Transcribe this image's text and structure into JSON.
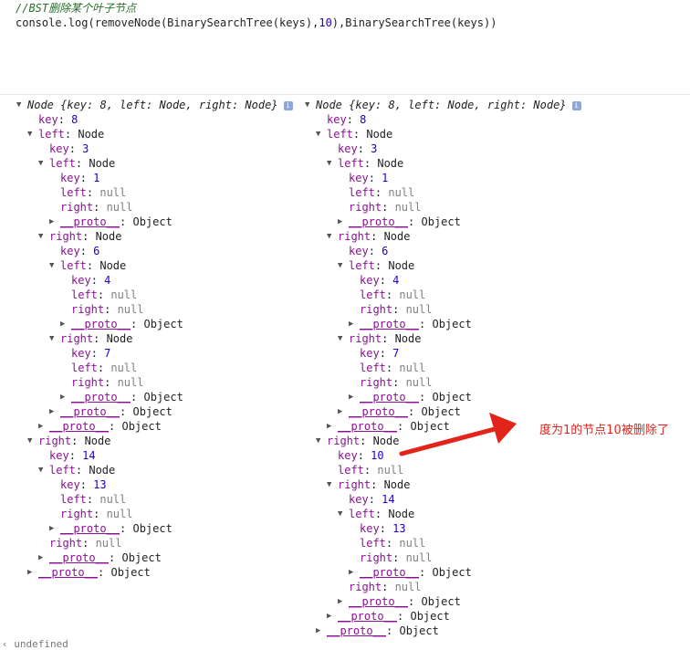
{
  "code": {
    "comment": "//BST删除某个叶子节点",
    "call_prefix": "console.log(removeNode(BinarySearchTree(keys),",
    "call_num": "10",
    "call_suffix": "),BinarySearchTree(keys))"
  },
  "left_tree": [
    {
      "kind": "head",
      "indent": 0,
      "tri": "open",
      "text": "Node {key: 8, left: Node, right: Node}"
    },
    {
      "kind": "kv",
      "indent": 1,
      "key": "key",
      "value": "8",
      "vtype": "num"
    },
    {
      "kind": "obj",
      "indent": 1,
      "tri": "open",
      "key": "left",
      "value": "Node"
    },
    {
      "kind": "kv",
      "indent": 2,
      "key": "key",
      "value": "3",
      "vtype": "num"
    },
    {
      "kind": "obj",
      "indent": 2,
      "tri": "open",
      "key": "left",
      "value": "Node"
    },
    {
      "kind": "kv",
      "indent": 3,
      "key": "key",
      "value": "1",
      "vtype": "num"
    },
    {
      "kind": "kv",
      "indent": 3,
      "key": "left",
      "value": "null",
      "vtype": "null"
    },
    {
      "kind": "kv",
      "indent": 3,
      "key": "right",
      "value": "null",
      "vtype": "null"
    },
    {
      "kind": "proto",
      "indent": 3,
      "tri": "closed",
      "key": "__proto__",
      "value": "Object"
    },
    {
      "kind": "obj",
      "indent": 2,
      "tri": "open",
      "key": "right",
      "value": "Node"
    },
    {
      "kind": "kv",
      "indent": 3,
      "key": "key",
      "value": "6",
      "vtype": "num"
    },
    {
      "kind": "obj",
      "indent": 3,
      "tri": "open",
      "key": "left",
      "value": "Node"
    },
    {
      "kind": "kv",
      "indent": 4,
      "key": "key",
      "value": "4",
      "vtype": "num"
    },
    {
      "kind": "kv",
      "indent": 4,
      "key": "left",
      "value": "null",
      "vtype": "null"
    },
    {
      "kind": "kv",
      "indent": 4,
      "key": "right",
      "value": "null",
      "vtype": "null"
    },
    {
      "kind": "proto",
      "indent": 4,
      "tri": "closed",
      "key": "__proto__",
      "value": "Object"
    },
    {
      "kind": "obj",
      "indent": 3,
      "tri": "open",
      "key": "right",
      "value": "Node"
    },
    {
      "kind": "kv",
      "indent": 4,
      "key": "key",
      "value": "7",
      "vtype": "num"
    },
    {
      "kind": "kv",
      "indent": 4,
      "key": "left",
      "value": "null",
      "vtype": "null"
    },
    {
      "kind": "kv",
      "indent": 4,
      "key": "right",
      "value": "null",
      "vtype": "null"
    },
    {
      "kind": "proto",
      "indent": 4,
      "tri": "closed",
      "key": "__proto__",
      "value": "Object"
    },
    {
      "kind": "proto",
      "indent": 3,
      "tri": "closed",
      "key": "__proto__",
      "value": "Object"
    },
    {
      "kind": "proto",
      "indent": 2,
      "tri": "closed",
      "key": "__proto__",
      "value": "Object"
    },
    {
      "kind": "obj",
      "indent": 1,
      "tri": "open",
      "key": "right",
      "value": "Node"
    },
    {
      "kind": "kv",
      "indent": 2,
      "key": "key",
      "value": "14",
      "vtype": "num"
    },
    {
      "kind": "obj",
      "indent": 2,
      "tri": "open",
      "key": "left",
      "value": "Node"
    },
    {
      "kind": "kv",
      "indent": 3,
      "key": "key",
      "value": "13",
      "vtype": "num"
    },
    {
      "kind": "kv",
      "indent": 3,
      "key": "left",
      "value": "null",
      "vtype": "null"
    },
    {
      "kind": "kv",
      "indent": 3,
      "key": "right",
      "value": "null",
      "vtype": "null"
    },
    {
      "kind": "proto",
      "indent": 3,
      "tri": "closed",
      "key": "__proto__",
      "value": "Object"
    },
    {
      "kind": "kv",
      "indent": 2,
      "key": "right",
      "value": "null",
      "vtype": "null"
    },
    {
      "kind": "proto",
      "indent": 2,
      "tri": "closed",
      "key": "__proto__",
      "value": "Object"
    },
    {
      "kind": "proto",
      "indent": 1,
      "tri": "closed",
      "key": "__proto__",
      "value": "Object"
    }
  ],
  "right_tree": [
    {
      "kind": "head",
      "indent": 0,
      "tri": "open",
      "text": "Node {key: 8, left: Node, right: Node}"
    },
    {
      "kind": "kv",
      "indent": 1,
      "key": "key",
      "value": "8",
      "vtype": "num"
    },
    {
      "kind": "obj",
      "indent": 1,
      "tri": "open",
      "key": "left",
      "value": "Node"
    },
    {
      "kind": "kv",
      "indent": 2,
      "key": "key",
      "value": "3",
      "vtype": "num"
    },
    {
      "kind": "obj",
      "indent": 2,
      "tri": "open",
      "key": "left",
      "value": "Node"
    },
    {
      "kind": "kv",
      "indent": 3,
      "key": "key",
      "value": "1",
      "vtype": "num"
    },
    {
      "kind": "kv",
      "indent": 3,
      "key": "left",
      "value": "null",
      "vtype": "null"
    },
    {
      "kind": "kv",
      "indent": 3,
      "key": "right",
      "value": "null",
      "vtype": "null"
    },
    {
      "kind": "proto",
      "indent": 3,
      "tri": "closed",
      "key": "__proto__",
      "value": "Object"
    },
    {
      "kind": "obj",
      "indent": 2,
      "tri": "open",
      "key": "right",
      "value": "Node"
    },
    {
      "kind": "kv",
      "indent": 3,
      "key": "key",
      "value": "6",
      "vtype": "num"
    },
    {
      "kind": "obj",
      "indent": 3,
      "tri": "open",
      "key": "left",
      "value": "Node"
    },
    {
      "kind": "kv",
      "indent": 4,
      "key": "key",
      "value": "4",
      "vtype": "num"
    },
    {
      "kind": "kv",
      "indent": 4,
      "key": "left",
      "value": "null",
      "vtype": "null"
    },
    {
      "kind": "kv",
      "indent": 4,
      "key": "right",
      "value": "null",
      "vtype": "null"
    },
    {
      "kind": "proto",
      "indent": 4,
      "tri": "closed",
      "key": "__proto__",
      "value": "Object"
    },
    {
      "kind": "obj",
      "indent": 3,
      "tri": "open",
      "key": "right",
      "value": "Node"
    },
    {
      "kind": "kv",
      "indent": 4,
      "key": "key",
      "value": "7",
      "vtype": "num"
    },
    {
      "kind": "kv",
      "indent": 4,
      "key": "left",
      "value": "null",
      "vtype": "null"
    },
    {
      "kind": "kv",
      "indent": 4,
      "key": "right",
      "value": "null",
      "vtype": "null"
    },
    {
      "kind": "proto",
      "indent": 4,
      "tri": "closed",
      "key": "__proto__",
      "value": "Object"
    },
    {
      "kind": "proto",
      "indent": 3,
      "tri": "closed",
      "key": "__proto__",
      "value": "Object"
    },
    {
      "kind": "proto",
      "indent": 2,
      "tri": "closed",
      "key": "__proto__",
      "value": "Object"
    },
    {
      "kind": "obj",
      "indent": 1,
      "tri": "open",
      "key": "right",
      "value": "Node"
    },
    {
      "kind": "kv",
      "indent": 2,
      "key": "key",
      "value": "10",
      "vtype": "num"
    },
    {
      "kind": "kv",
      "indent": 2,
      "key": "left",
      "value": "null",
      "vtype": "null"
    },
    {
      "kind": "obj",
      "indent": 2,
      "tri": "open",
      "key": "right",
      "value": "Node"
    },
    {
      "kind": "kv",
      "indent": 3,
      "key": "key",
      "value": "14",
      "vtype": "num"
    },
    {
      "kind": "obj",
      "indent": 3,
      "tri": "open",
      "key": "left",
      "value": "Node"
    },
    {
      "kind": "kv",
      "indent": 4,
      "key": "key",
      "value": "13",
      "vtype": "num"
    },
    {
      "kind": "kv",
      "indent": 4,
      "key": "left",
      "value": "null",
      "vtype": "null"
    },
    {
      "kind": "kv",
      "indent": 4,
      "key": "right",
      "value": "null",
      "vtype": "null"
    },
    {
      "kind": "proto",
      "indent": 4,
      "tri": "closed",
      "key": "__proto__",
      "value": "Object"
    },
    {
      "kind": "kv",
      "indent": 3,
      "key": "right",
      "value": "null",
      "vtype": "null"
    },
    {
      "kind": "proto",
      "indent": 3,
      "tri": "closed",
      "key": "__proto__",
      "value": "Object"
    },
    {
      "kind": "proto",
      "indent": 2,
      "tri": "closed",
      "key": "__proto__",
      "value": "Object"
    },
    {
      "kind": "proto",
      "indent": 1,
      "tri": "closed",
      "key": "__proto__",
      "value": "Object"
    }
  ],
  "annotation": {
    "text": "度为1的节点10被删除了",
    "color": "#e3241b"
  },
  "footer": {
    "text": "‹ undefined"
  },
  "colors": {
    "key": "#881391",
    "number": "#1c00cf",
    "null": "#808080",
    "comment": "#236e25"
  }
}
